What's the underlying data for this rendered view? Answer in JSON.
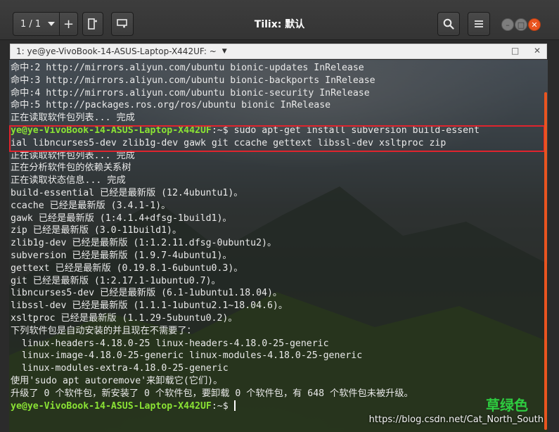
{
  "window": {
    "title": "Tilix: 默认",
    "session_counter": "1 / 1"
  },
  "terminal_title": "1: ye@ye-VivoBook-14-ASUS-Laptop-X442UF: ~",
  "icons": {
    "session_dropdown": "chevron-down-icon",
    "add_session": "plus-icon",
    "add_terminal_right": "split-right-icon",
    "add_terminal_down": "split-down-icon",
    "search": "search-icon",
    "menu": "hamburger-icon",
    "minimize": "minimize-icon",
    "maximize": "maximize-icon",
    "close": "close-icon"
  },
  "colors": {
    "prompt": "#8ae234",
    "highlight_border": "#e0242d",
    "accent": "#e95420"
  },
  "terminal": {
    "lines": [
      {
        "text": "命中:2 http://mirrors.aliyun.com/ubuntu bionic-updates InRelease"
      },
      {
        "text": "命中:3 http://mirrors.aliyun.com/ubuntu bionic-backports InRelease"
      },
      {
        "text": "命中:4 http://mirrors.aliyun.com/ubuntu bionic-security InRelease"
      },
      {
        "text": "命中:5 http://packages.ros.org/ros/ubuntu bionic InRelease"
      },
      {
        "text": "正在读取软件包列表... 完成"
      },
      {
        "prompt": "ye@ye-VivoBook-14-ASUS-Laptop-X442UF",
        "text": ":~$ sudo apt-get install subversion build-essent"
      },
      {
        "text": "ial libncurses5-dev zlib1g-dev gawk git ccache gettext libssl-dev xsltproc zip"
      },
      {
        "text": "正在读取软件包列表... 完成"
      },
      {
        "text": "正在分析软件包的依赖关系树"
      },
      {
        "text": "正在读取状态信息... 完成"
      },
      {
        "text": "build-essential 已经是最新版 (12.4ubuntu1)。"
      },
      {
        "text": "ccache 已经是最新版 (3.4.1-1)。"
      },
      {
        "text": "gawk 已经是最新版 (1:4.1.4+dfsg-1build1)。"
      },
      {
        "text": "zip 已经是最新版 (3.0-11build1)。"
      },
      {
        "text": "zlib1g-dev 已经是最新版 (1:1.2.11.dfsg-0ubuntu2)。"
      },
      {
        "text": "subversion 已经是最新版 (1.9.7-4ubuntu1)。"
      },
      {
        "text": "gettext 已经是最新版 (0.19.8.1-6ubuntu0.3)。"
      },
      {
        "text": "git 已经是最新版 (1:2.17.1-1ubuntu0.7)。"
      },
      {
        "text": "libncurses5-dev 已经是最新版 (6.1-1ubuntu1.18.04)。"
      },
      {
        "text": "libssl-dev 已经是最新版 (1.1.1-1ubuntu2.1~18.04.6)。"
      },
      {
        "text": "xsltproc 已经是最新版 (1.1.29-5ubuntu0.2)。"
      },
      {
        "text": "下列软件包是自动安装的并且现在不需要了："
      },
      {
        "text": "  linux-headers-4.18.0-25 linux-headers-4.18.0-25-generic"
      },
      {
        "text": "  linux-image-4.18.0-25-generic linux-modules-4.18.0-25-generic"
      },
      {
        "text": "  linux-modules-extra-4.18.0-25-generic"
      },
      {
        "text": "使用'sudo apt autoremove'来卸载它(它们)。"
      },
      {
        "text": "升级了 0 个软件包，新安装了 0 个软件包，要卸载 0 个软件包，有 648 个软件包未被升级。"
      },
      {
        "prompt": "ye@ye-VivoBook-14-ASUS-Laptop-X442UF",
        "text": ":~$ ",
        "cursor": true
      }
    ]
  },
  "watermark": {
    "url": "https://blog.csdn.net/Cat_North_South",
    "overlay_text": "草绿色"
  }
}
